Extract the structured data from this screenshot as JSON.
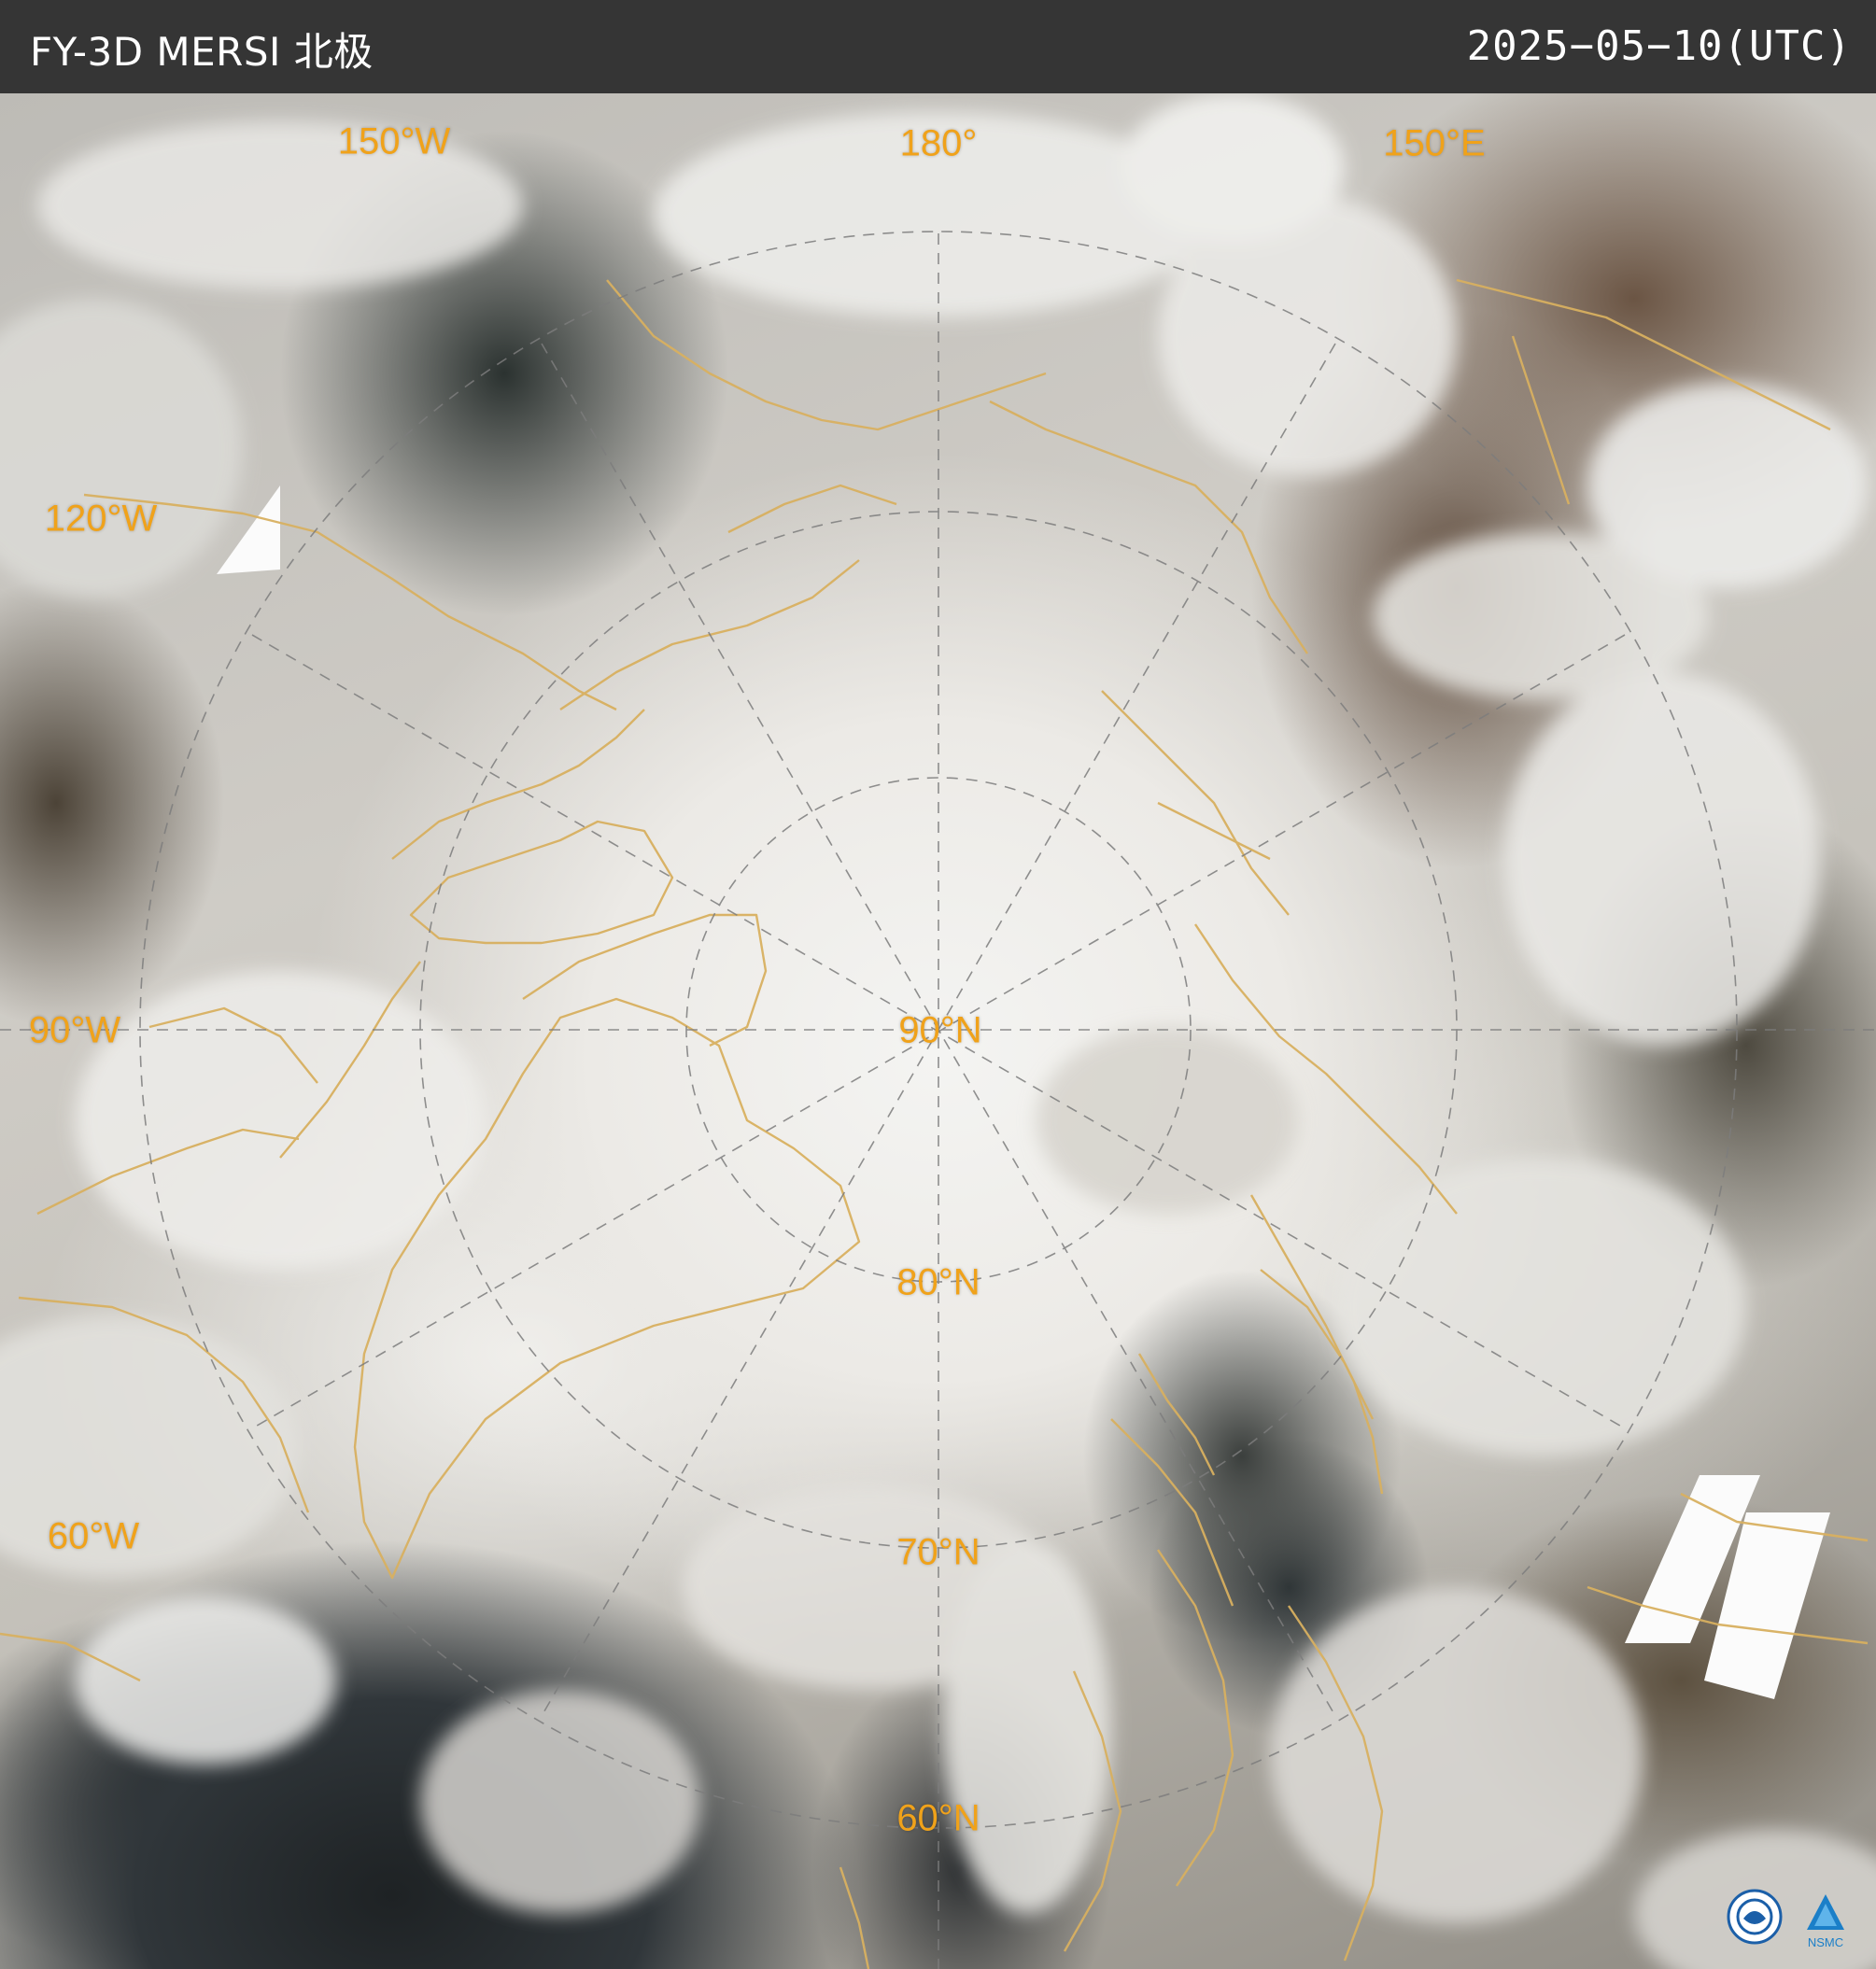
{
  "header": {
    "title": "FY-3D MERSI 北极",
    "date": "2025−05−10(UTC)"
  },
  "map": {
    "center_label": "90°N",
    "latitude_labels": [
      "80°N",
      "70°N",
      "60°N"
    ],
    "longitude_labels": [
      "150°W",
      "180°",
      "150°E",
      "120°W",
      "90°W",
      "60°W"
    ],
    "colors": {
      "label": "#f0a21a",
      "coastline": "#d8b060",
      "grid": "#8a8a8a",
      "header_bg": "#353535"
    }
  },
  "logos": {
    "left_icon": "cma-logo-icon",
    "right_icon": "nsmc-logo-icon",
    "right_text": "NSMC"
  }
}
